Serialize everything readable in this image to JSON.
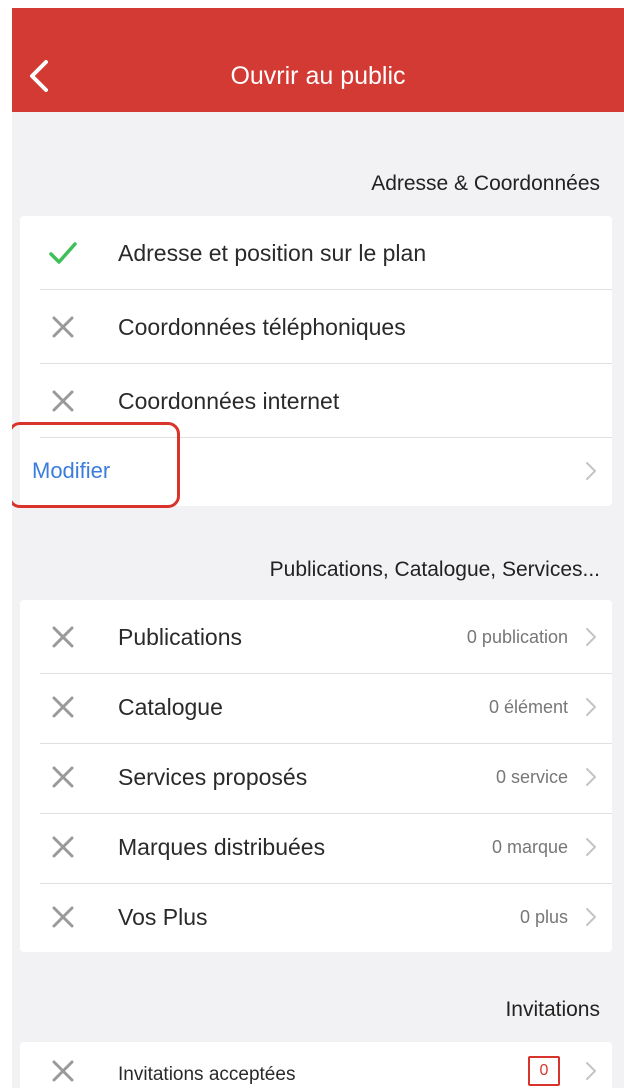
{
  "navbar": {
    "title": "Ouvrir au public",
    "back_icon": "chevron-left-icon",
    "background": "#d33a33"
  },
  "sections": {
    "contact": {
      "header": "Adresse & Coordonnées",
      "items": [
        {
          "label": "Adresse et position sur le plan",
          "status": "done"
        },
        {
          "label": "Coordonnées téléphoniques",
          "status": "missing"
        },
        {
          "label": "Coordonnées internet",
          "status": "missing"
        }
      ],
      "action_label": "Modifier"
    },
    "content": {
      "header": "Publications, Catalogue, Services...",
      "items": [
        {
          "label": "Publications",
          "value": "0 publication",
          "status": "missing"
        },
        {
          "label": "Catalogue",
          "value": "0 élément",
          "status": "missing"
        },
        {
          "label": "Services proposés",
          "value": "0 service",
          "status": "missing"
        },
        {
          "label": "Marques distribuées",
          "value": "0 marque",
          "status": "missing"
        },
        {
          "label": "Vos Plus",
          "value": "0 plus",
          "status": "missing"
        }
      ]
    },
    "invitations": {
      "header": "Invitations",
      "items": [
        {
          "label": "Invitations acceptées",
          "badge": "0",
          "status": "missing"
        }
      ]
    }
  },
  "colors": {
    "accent": "#d33a33",
    "check": "#3fbf5a",
    "cross": "#9a9a9a",
    "link": "#3b7ddd",
    "background": "#f2f2f4"
  }
}
